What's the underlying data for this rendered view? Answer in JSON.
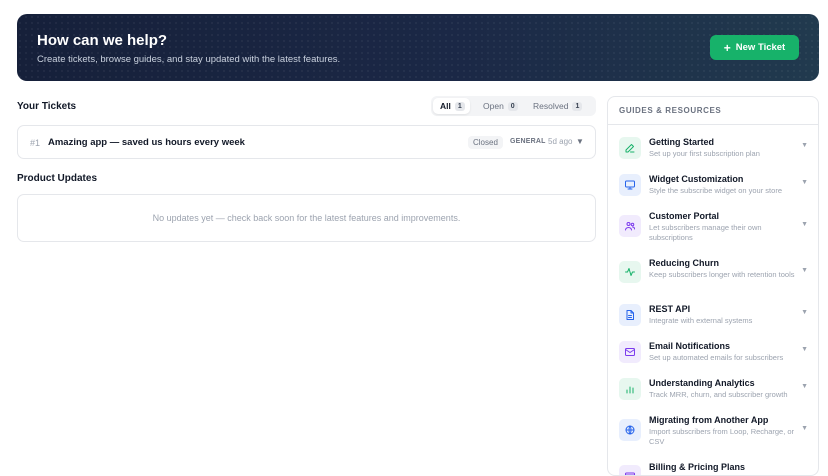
{
  "hero": {
    "title": "How can we help?",
    "subtitle": "Create tickets, browse guides, and stay updated with the latest features.",
    "new_ticket_plus": "+",
    "new_ticket_label": "New Ticket"
  },
  "tickets": {
    "heading": "Your Tickets",
    "tabs": [
      {
        "label": "All",
        "count": "1"
      },
      {
        "label": "Open",
        "count": "0"
      },
      {
        "label": "Resolved",
        "count": "1"
      }
    ],
    "items": [
      {
        "id": "#1",
        "title": "Amazing app — saved us hours every week",
        "status": "Closed",
        "category": "GENERAL",
        "time": "5d ago",
        "caret": "▼"
      }
    ]
  },
  "updates": {
    "heading": "Product Updates",
    "empty": "No updates yet — check back soon for the latest features and improvements."
  },
  "guides": {
    "heading": "GUIDES & RESOURCES",
    "caret": "▼",
    "items": [
      {
        "title": "Getting Started",
        "desc": "Set up your first subscription plan",
        "icon": "pencil-icon",
        "color": "#17b26a",
        "bg": "#e7f7ef"
      },
      {
        "title": "Widget Customization",
        "desc": "Style the subscribe widget on your store",
        "icon": "monitor-icon",
        "color": "#2563eb",
        "bg": "#e8effd"
      },
      {
        "title": "Customer Portal",
        "desc": "Let subscribers manage their own subscriptions",
        "icon": "users-icon",
        "color": "#7c3aed",
        "bg": "#f1ebfd"
      },
      {
        "title": "Reducing Churn",
        "desc": "Keep subscribers longer with retention tools",
        "icon": "activity-icon",
        "color": "#17b26a",
        "bg": "#e7f7ef"
      },
      {
        "title": "REST API",
        "desc": "Integrate with external systems",
        "icon": "file-icon",
        "color": "#2563eb",
        "bg": "#e8effd"
      },
      {
        "title": "Email Notifications",
        "desc": "Set up automated emails for subscribers",
        "icon": "mail-icon",
        "color": "#7c3aed",
        "bg": "#f1ebfd"
      },
      {
        "title": "Understanding Analytics",
        "desc": "Track MRR, churn, and subscriber growth",
        "icon": "bar-chart-icon",
        "color": "#17b26a",
        "bg": "#e7f7ef"
      },
      {
        "title": "Migrating from Another App",
        "desc": "Import subscribers from Loop, Recharge, or CSV",
        "icon": "globe-icon",
        "color": "#2563eb",
        "bg": "#e8effd"
      },
      {
        "title": "Billing & Pricing Plans",
        "desc": "",
        "icon": "credit-card-icon",
        "color": "#7c3aed",
        "bg": "#f1ebfd"
      }
    ]
  }
}
